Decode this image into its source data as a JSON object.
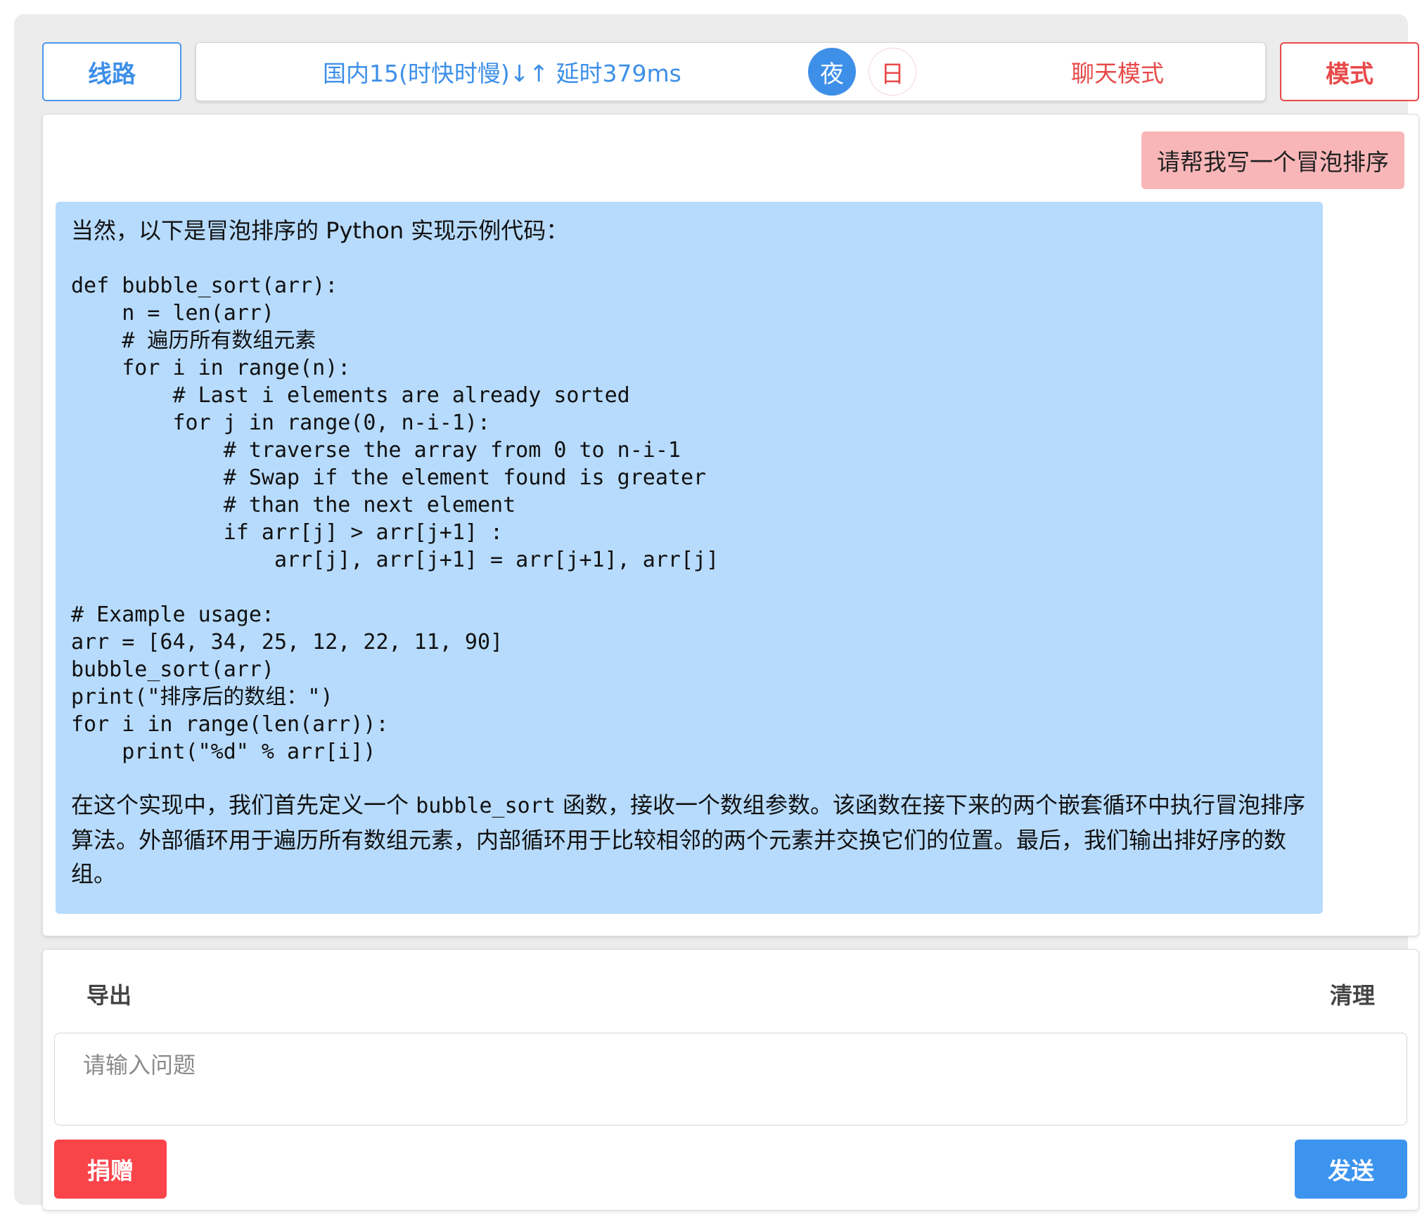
{
  "topbar": {
    "route_button": "线路",
    "route_status": "国内15(时快时慢)↓↑ 延时379ms",
    "theme_night": "夜",
    "theme_day": "日",
    "mode_status": "聊天模式",
    "mode_button": "模式"
  },
  "chat": {
    "user_message": "请帮我写一个冒泡排序",
    "bot_intro": "当然，以下是冒泡排序的 Python 实现示例代码：",
    "bot_code": "def bubble_sort(arr):\n    n = len(arr)\n    # 遍历所有数组元素\n    for i in range(n):\n        # Last i elements are already sorted\n        for j in range(0, n-i-1):\n            # traverse the array from 0 to n-i-1\n            # Swap if the element found is greater\n            # than the next element\n            if arr[j] > arr[j+1] :\n                arr[j], arr[j+1] = arr[j+1], arr[j]\n\n# Example usage:\narr = [64, 34, 25, 12, 22, 11, 90]\nbubble_sort(arr)\nprint(\"排序后的数组：\")\nfor i in range(len(arr)):\n    print(\"%d\" % arr[i])",
    "bot_outro_pre": "在这个实现中，我们首先定义一个 ",
    "bot_outro_code": "bubble_sort",
    "bot_outro_post": " 函数，接收一个数组参数。该函数在接下来的两个嵌套循环中执行冒泡排序算法。外部循环用于遍历所有数组元素，内部循环用于比较相邻的两个元素并交换它们的位置。最后，我们输出排好序的数组。"
  },
  "bottom": {
    "export_label": "导出",
    "clear_label": "清理",
    "input_placeholder": "请输入问题",
    "input_value": "",
    "donate_label": "捐赠",
    "send_label": "发送"
  },
  "colors": {
    "accent_blue": "#3d8fe8",
    "accent_red": "#e84a4a",
    "user_bubble": "#f9b6b8",
    "bot_bubble": "#b7dbfd",
    "donate": "#f9444a",
    "send": "#3d94ef"
  }
}
